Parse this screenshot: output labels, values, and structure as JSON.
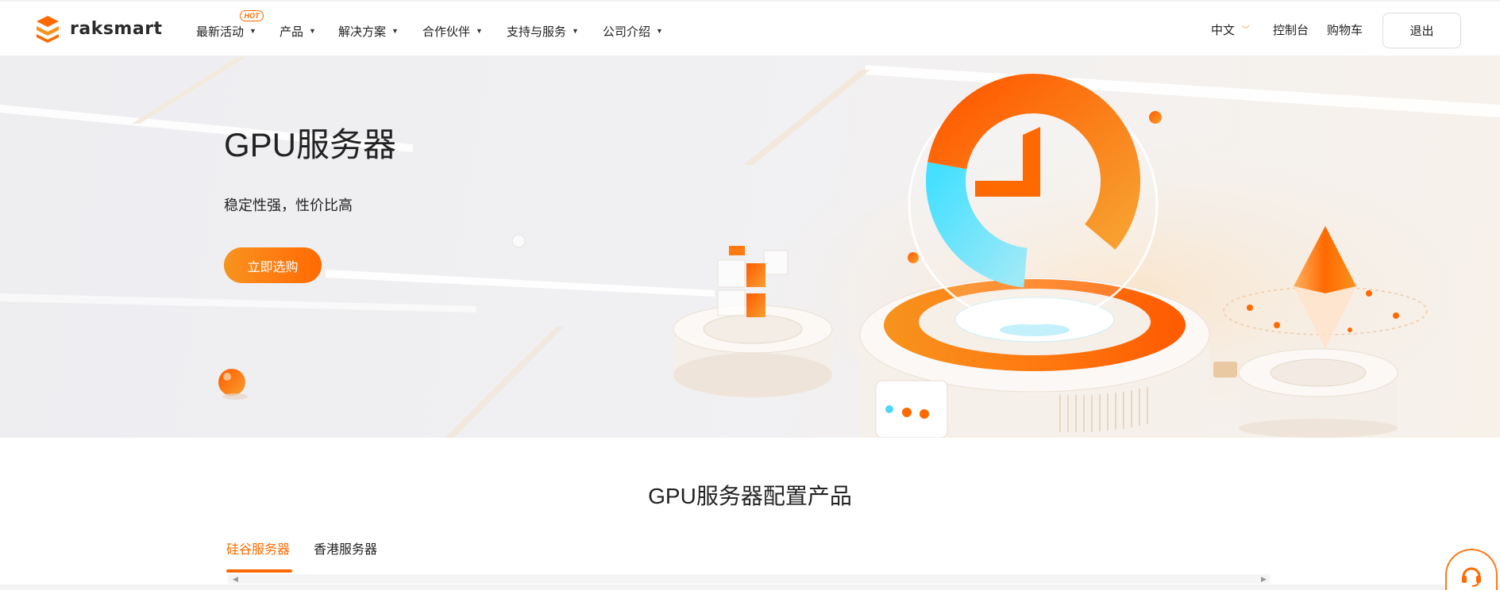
{
  "header": {
    "logo_text": "raksmart",
    "nav": [
      {
        "label": "最新活动"
      },
      {
        "label": "产品"
      },
      {
        "label": "解决方案"
      },
      {
        "label": "合作伙伴"
      },
      {
        "label": "支持与服务"
      },
      {
        "label": "公司介绍"
      }
    ],
    "hot_badge": "HOT",
    "language": "中文",
    "console": "控制台",
    "cart": "购物车",
    "logout": "退出"
  },
  "hero": {
    "title": "GPU服务器",
    "subtitle": "稳定性强，性价比高",
    "cta": "立即选购"
  },
  "products": {
    "title": "GPU服务器配置产品",
    "tabs": [
      {
        "label": "硅谷服务器",
        "active": true
      },
      {
        "label": "香港服务器",
        "active": false
      }
    ]
  },
  "icons": {
    "logo": "raksmart-logo-icon",
    "nav_caret": "caret-down-icon",
    "language_chevron": "chevron-down-icon",
    "scroll_left": "arrow-left-icon",
    "scroll_right": "arrow-right-icon",
    "support": "headset-icon"
  },
  "colors": {
    "accent": "#ff6a00",
    "accent_light": "#f7931e",
    "cyan": "#4fd8f5",
    "text": "#222222"
  }
}
